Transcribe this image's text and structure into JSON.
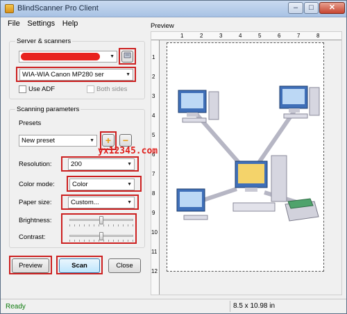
{
  "window": {
    "title": "BlindScanner Pro Client",
    "minimize_glyph": "–",
    "maximize_glyph": "□",
    "close_glyph": "✕"
  },
  "menu": [
    "File",
    "Settings",
    "Help"
  ],
  "server_scanners": {
    "group_label": "Server & scanners",
    "server_combo_value": "",
    "scanner_combo_value": "WIA-WIA Canon MP280 ser",
    "use_adf_label": "Use ADF",
    "both_sides_label": "Both sides"
  },
  "scanning_parameters": {
    "group_label": "Scanning parameters",
    "presets_label": "Presets",
    "preset_value": "New preset",
    "resolution_label": "Resolution:",
    "resolution_value": "200",
    "color_mode_label": "Color mode:",
    "color_mode_value": "Color",
    "paper_size_label": "Paper size:",
    "paper_size_value": "Custom...",
    "brightness_label": "Brightness:",
    "contrast_label": "Contrast:",
    "brightness_level": 0.5,
    "contrast_level": 0.5
  },
  "buttons": {
    "preview": "Preview",
    "scan": "Scan",
    "close": "Close"
  },
  "preview": {
    "group_label": "Preview",
    "h_ruler_ticks": [
      "1",
      "2",
      "3",
      "4",
      "5",
      "6",
      "7",
      "8"
    ],
    "v_ruler_ticks": [
      "1",
      "2",
      "3",
      "4",
      "5",
      "6",
      "7",
      "8",
      "9",
      "10",
      "11",
      "12"
    ]
  },
  "watermark": "yx12345.com",
  "status": {
    "ready": "Ready",
    "page_size": "8.5 x 10.98 in"
  },
  "colors": {
    "annotation_red": "#cc1f1f",
    "status_green": "#0b7a0b",
    "watermark_red": "#e0201c"
  },
  "icons": [
    "scanner-settings-icon",
    "add-preset-icon",
    "remove-preset-icon",
    "app-icon"
  ]
}
